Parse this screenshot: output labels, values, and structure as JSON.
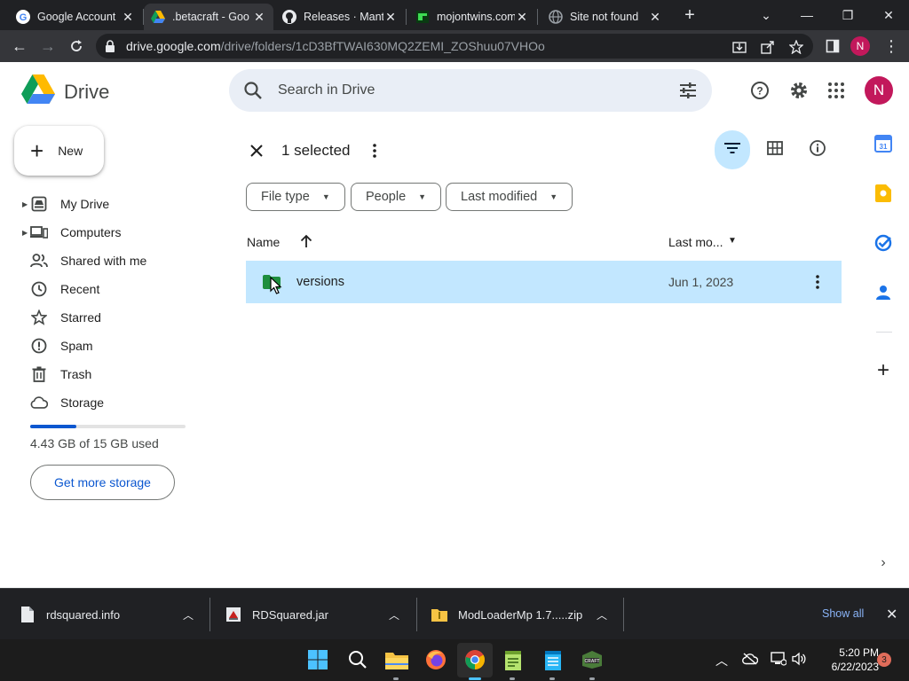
{
  "browser": {
    "tabs": [
      {
        "title": "Google Account",
        "icon": "google-g-icon"
      },
      {
        "title": ".betacraft - Goo",
        "icon": "drive-icon"
      },
      {
        "title": "Releases · Mant",
        "icon": "github-icon"
      },
      {
        "title": "mojontwins.com",
        "icon": "mojontwins-icon"
      },
      {
        "title": "Site not found",
        "icon": "globe-icon"
      }
    ],
    "url_host": "drive.google.com",
    "url_path": "/drive/folders/1cD3BfTWAI630MQ2ZEMI_ZOShuu07VHOo",
    "profile_initial": "N"
  },
  "drive": {
    "app_name": "Drive",
    "search_placeholder": "Search in Drive",
    "avatar_initial": "N",
    "new_label": "New",
    "nav": [
      {
        "label": "My Drive",
        "icon": "my-drive-icon",
        "expandable": true
      },
      {
        "label": "Computers",
        "icon": "computers-icon",
        "expandable": true
      },
      {
        "label": "Shared with me",
        "icon": "people-icon",
        "expandable": false
      },
      {
        "label": "Recent",
        "icon": "clock-icon",
        "expandable": false
      },
      {
        "label": "Starred",
        "icon": "star-icon",
        "expandable": false
      },
      {
        "label": "Spam",
        "icon": "spam-icon",
        "expandable": false
      },
      {
        "label": "Trash",
        "icon": "trash-icon",
        "expandable": false
      },
      {
        "label": "Storage",
        "icon": "cloud-icon",
        "expandable": false
      }
    ],
    "storage_used_fraction": 0.295,
    "storage_text": "4.43 GB of 15 GB used",
    "get_more_label": "Get more storage",
    "selection_label": "1 selected",
    "filters": [
      {
        "label": "File type"
      },
      {
        "label": "People"
      },
      {
        "label": "Last modified"
      }
    ],
    "columns": {
      "name": "Name",
      "modified": "Last mo..."
    },
    "files": [
      {
        "name": "versions",
        "modified": "Jun 1, 2023",
        "type": "folder",
        "folder_color": "#1e8e3e",
        "selected": true
      }
    ],
    "selection_color": "#c2e7ff"
  },
  "downloads": {
    "items": [
      {
        "name": "rdsquared.info"
      },
      {
        "name": "RDSquared.jar"
      },
      {
        "name": "ModLoaderMp 1.7.....zip"
      }
    ],
    "show_all_label": "Show all"
  },
  "taskbar": {
    "time": "5:20 PM",
    "date": "6/22/2023",
    "notification_count": "3"
  }
}
